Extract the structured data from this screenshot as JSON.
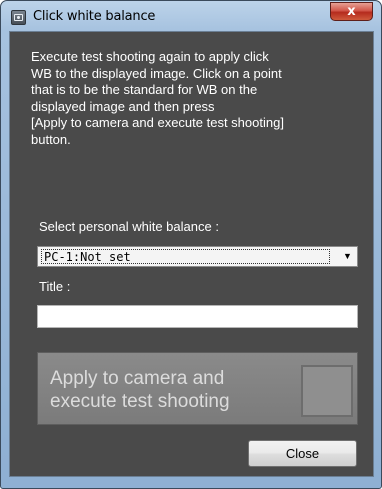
{
  "window": {
    "title": "Click white balance",
    "close_glyph": "x"
  },
  "instructions": "Execute test shooting again to apply click\nWB to the displayed image. Click on a point\nthat is to be the standard for WB on the\ndisplayed image and then press\n[Apply to camera and execute test shooting]\nbutton.",
  "personal_wb": {
    "label": "Select personal white balance :",
    "selected": "PC-1:Not set",
    "arrow_glyph": "▼"
  },
  "title_field": {
    "label": "Title :",
    "value": ""
  },
  "apply_button": {
    "label": "Apply to camera and\nexecute test shooting"
  },
  "close_button": {
    "label": "Close"
  },
  "icons": {
    "title_bar": "camera-icon",
    "close": "close-icon",
    "dropdown": "chevron-down-icon"
  },
  "colors": {
    "client_background": "#4a4a4a",
    "title_bar": "#a6c2df",
    "close_button_red": "#c8382a"
  }
}
